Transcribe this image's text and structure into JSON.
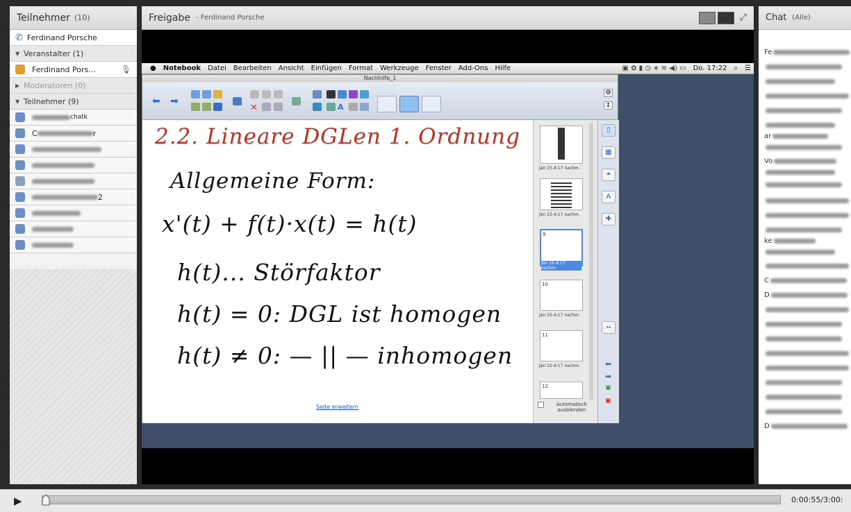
{
  "left": {
    "title": "Teilnehmer",
    "count": "(10)",
    "host_row": "Ferdinand Porsche",
    "sections": {
      "hosts": "Veranstalter (1)",
      "moderators": "Moderatoren (0)",
      "participants": "Teilnehmer (9)"
    },
    "host_name": "Ferdinand Pors...",
    "participant_visible_fragments": [
      "chatk",
      "C",
      "r",
      "",
      "",
      "",
      "2",
      "",
      "",
      ""
    ]
  },
  "center": {
    "title": "Freigabe",
    "subtitle": "- Ferdinand Porsche",
    "macbar": {
      "app": "Notebook",
      "menus": [
        "Datei",
        "Bearbeiten",
        "Ansicht",
        "Einfügen",
        "Format",
        "Werkzeuge",
        "Fenster",
        "Add-Ons",
        "Hilfe"
      ],
      "clock": "Do. 17:22"
    },
    "window_title": "Nachhilfe_1",
    "board": {
      "heading": "2.2. Lineare DGLen 1. Ordnung",
      "lines": [
        "Allgemeine Form:",
        "x'(t) + f(t)·x(t) = h(t)",
        "h(t)... Störfaktor",
        "h(t) = 0: DGL ist homogen",
        "h(t) ≠ 0: — || — inhomogen"
      ],
      "link": "Seite erweitern"
    },
    "sorter": {
      "thumbs": [
        {
          "num": "",
          "time": "Jän 15-4:17 nachm."
        },
        {
          "num": "",
          "time": "Jän 15-4:17 nachm."
        },
        {
          "num": "9",
          "time": "Jän 15-4:17 nachm."
        },
        {
          "num": "10",
          "time": "Jän 15-4:17 nachm."
        },
        {
          "num": "11",
          "time": "Jän 15-4:17 nachm."
        },
        {
          "num": "12",
          "time": ""
        }
      ],
      "auto_hide": "Automatisch ausblenden"
    }
  },
  "right": {
    "title": "Chat",
    "filter": "(Alle)",
    "visible_fragments": [
      "Fe",
      "",
      "",
      "",
      "",
      "",
      "ar",
      "",
      "Vo",
      "",
      "",
      "",
      "",
      "",
      "ke",
      "",
      "",
      "C",
      "D",
      "",
      "",
      "",
      "",
      "",
      "",
      "",
      "",
      "D"
    ]
  },
  "transport": {
    "time": "0:00:55/3:00:",
    "progress": 0.0
  }
}
